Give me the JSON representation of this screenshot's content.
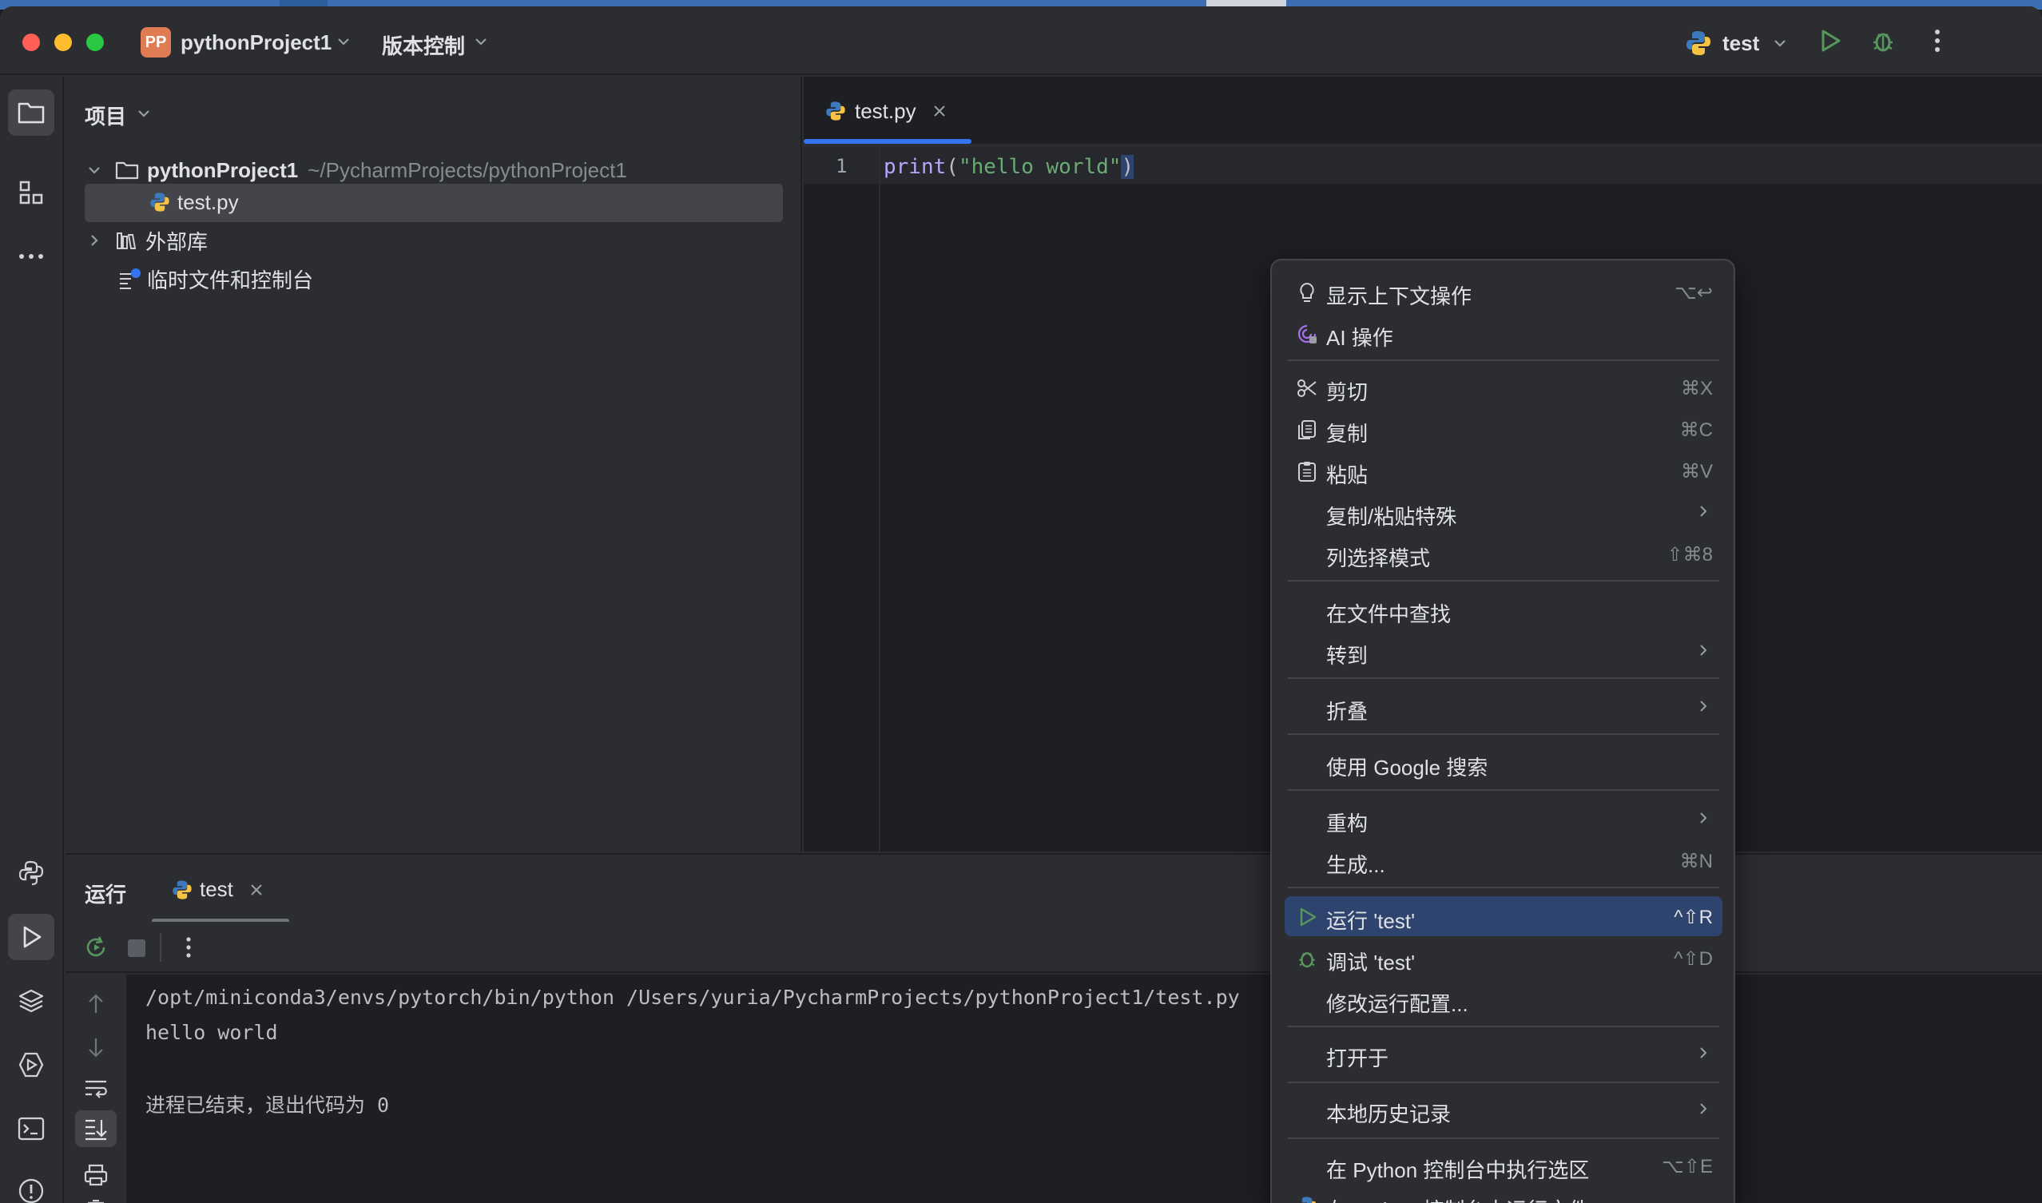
{
  "title_bar": {
    "project_badge": "PP",
    "project_name": "pythonProject1",
    "vcs_label": "版本控制",
    "run_config": "test",
    "icons": [
      "chevron-down-icon",
      "python-icon",
      "run-icon",
      "debug-icon",
      "more-vert-icon"
    ]
  },
  "left_strip": {
    "icons": [
      "folder-icon",
      "structure-icon",
      "more-horiz-icon",
      "python-console-icon",
      "run-panel-icon",
      "layers-icon",
      "services-icon",
      "terminal-icon",
      "problems-icon"
    ]
  },
  "project_panel": {
    "title": "项目",
    "root_name": "pythonProject1",
    "root_path": "~/PycharmProjects/pythonProject1",
    "file": "test.py",
    "external_libs": "外部库",
    "scratches": "临时文件和控制台"
  },
  "editor": {
    "tab_label": "test.py",
    "line_number": "1",
    "code_fn": "print",
    "code_open": "(",
    "code_str": "\"hello world\"",
    "code_close": ")"
  },
  "run_panel": {
    "title": "运行",
    "tab_label": "test",
    "console_line1": "/opt/miniconda3/envs/pytorch/bin/python /Users/yuria/PycharmProjects/pythonProject1/test.py",
    "console_line2": "hello world",
    "console_line4": "进程已结束，退出代码为 0"
  },
  "context_menu": {
    "items": [
      {
        "label": "显示上下文操作",
        "shortcut": "⌥↩",
        "icon": "lightbulb-icon"
      },
      {
        "label": "AI 操作",
        "shortcut": "",
        "icon": "ai-icon"
      },
      {
        "label": "剪切",
        "shortcut": "⌘X",
        "icon": "scissors-icon"
      },
      {
        "label": "复制",
        "shortcut": "⌘C",
        "icon": "copy-icon"
      },
      {
        "label": "粘贴",
        "shortcut": "⌘V",
        "icon": "paste-icon"
      },
      {
        "label": "复制/粘贴特殊",
        "shortcut": "",
        "icon": ""
      },
      {
        "label": "列选择模式",
        "shortcut": "⇧⌘8",
        "icon": ""
      },
      {
        "label": "在文件中查找",
        "shortcut": "",
        "icon": ""
      },
      {
        "label": "转到",
        "shortcut": "",
        "icon": ""
      },
      {
        "label": "折叠",
        "shortcut": "",
        "icon": ""
      },
      {
        "label": "使用 Google 搜索",
        "shortcut": "",
        "icon": ""
      },
      {
        "label": "重构",
        "shortcut": "",
        "icon": ""
      },
      {
        "label": "生成...",
        "shortcut": "⌘N",
        "icon": ""
      },
      {
        "label": "运行 'test'",
        "shortcut": "^⇧R",
        "icon": "run-icon"
      },
      {
        "label": "调试 'test'",
        "shortcut": "^⇧D",
        "icon": "debug-icon"
      },
      {
        "label": "修改运行配置...",
        "shortcut": "",
        "icon": ""
      },
      {
        "label": "打开于",
        "shortcut": "",
        "icon": ""
      },
      {
        "label": "本地历史记录",
        "shortcut": "",
        "icon": ""
      },
      {
        "label": "在 Python 控制台中执行选区",
        "shortcut": "⌥⇧E",
        "icon": ""
      },
      {
        "label": "在 Python 控制台中运行文件",
        "shortcut": "",
        "icon": "python-icon"
      }
    ]
  },
  "colors": {
    "accent": "#3574f0",
    "menu_highlight": "#2e436e",
    "run_green": "#57965c",
    "python_yellow": "#f5c244",
    "python_blue": "#3c7abd"
  }
}
